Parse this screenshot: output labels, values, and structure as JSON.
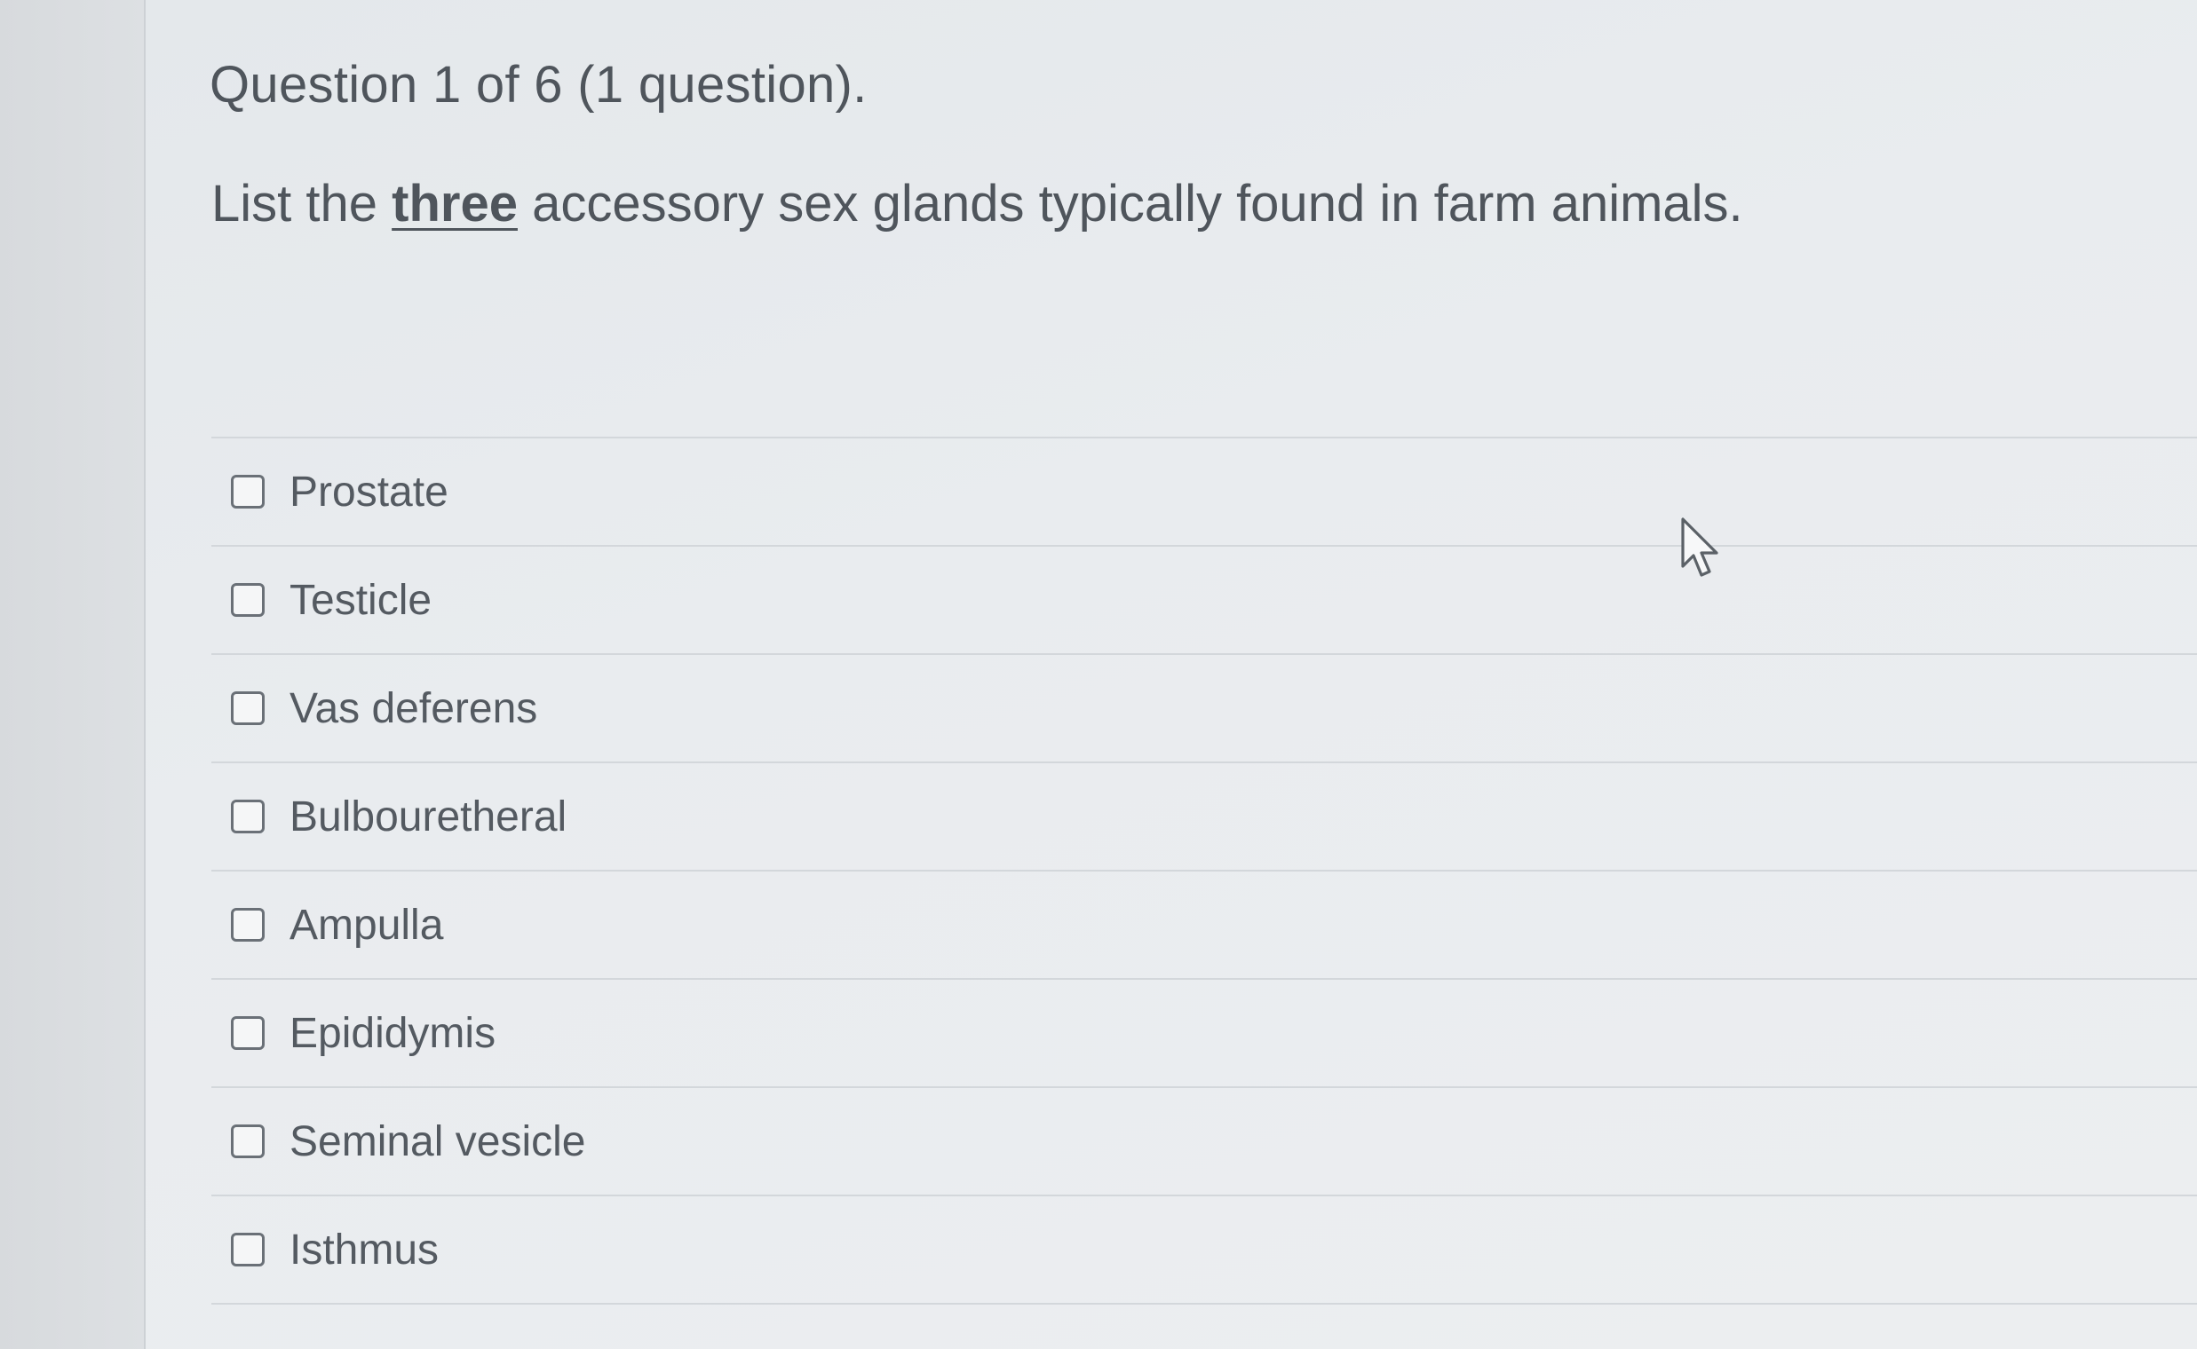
{
  "question": {
    "header": "Question 1 of 6 (1 question).",
    "prompt_before": "List the ",
    "prompt_emphasis": "three",
    "prompt_after": " accessory sex glands typically found in farm animals."
  },
  "options": [
    {
      "label": "Prostate",
      "checked": false
    },
    {
      "label": "Testicle",
      "checked": false
    },
    {
      "label": "Vas deferens",
      "checked": false
    },
    {
      "label": "Bulbouretheral",
      "checked": false
    },
    {
      "label": "Ampulla",
      "checked": false
    },
    {
      "label": "Epididymis",
      "checked": false
    },
    {
      "label": "Seminal vesicle",
      "checked": false
    },
    {
      "label": "Isthmus",
      "checked": false
    }
  ],
  "icons": {
    "checkbox": "checkbox-unchecked-icon",
    "cursor": "mouse-pointer-icon"
  }
}
